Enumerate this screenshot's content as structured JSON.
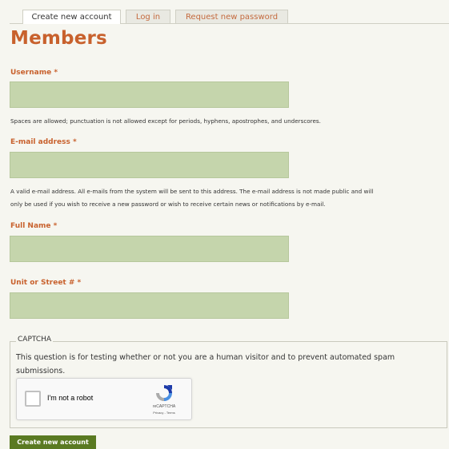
{
  "tabs": [
    {
      "label": "Create new account",
      "active": true
    },
    {
      "label": "Log in",
      "active": false
    },
    {
      "label": "Request new password",
      "active": false
    }
  ],
  "page_title": "Members",
  "required_marker": "*",
  "fields": {
    "username": {
      "label": "Username",
      "value": "",
      "help": "Spaces are allowed; punctuation is not allowed except for periods, hyphens, apostrophes, and underscores."
    },
    "email": {
      "label": "E-mail address",
      "value": "",
      "help_line1": "A valid e-mail address. All e-mails from the system will be sent to this address. The e-mail address is not made public and will",
      "help_line2": "only be used if you wish to receive a new password or wish to receive certain news or notifications by e-mail."
    },
    "full_name": {
      "label": "Full Name",
      "value": ""
    },
    "unit_street": {
      "label": "Unit or Street #",
      "value": ""
    }
  },
  "captcha": {
    "legend": "CAPTCHA",
    "description": "This question is for testing whether or not you are a human visitor and to prevent automated spam submissions.",
    "recaptcha_label": "I'm not a robot",
    "recaptcha_brand": "reCAPTCHA",
    "recaptcha_terms": "Privacy - Terms",
    "checked": false
  },
  "submit_label": "Create new account",
  "colors": {
    "accent": "#c8612d",
    "field_bg": "#c5d5ac",
    "button_bg": "#5a7a22",
    "page_bg": "#f6f6f0"
  }
}
